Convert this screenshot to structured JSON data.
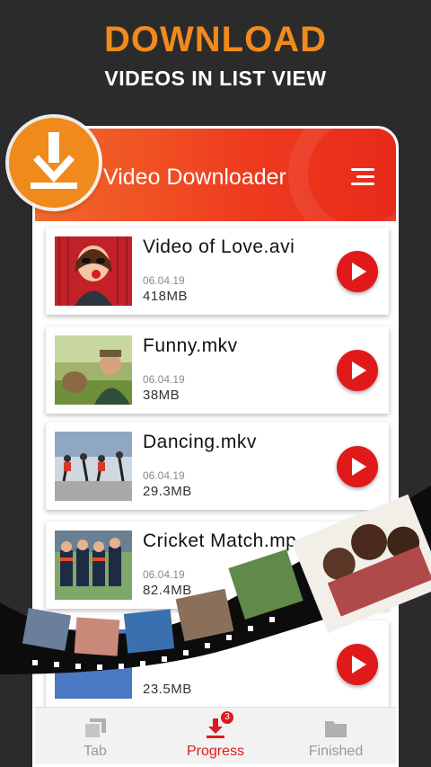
{
  "promo": {
    "title": "DOWNLOAD",
    "subtitle": "VIDEOS IN LIST VIEW"
  },
  "appbar": {
    "title": "Video Downloader",
    "menu_icon": "hamburger-menu-icon",
    "badge_icon": "download-arrow-icon"
  },
  "videos": [
    {
      "title": "Video of Love.avi",
      "date": "06.04.19",
      "size": "418MB"
    },
    {
      "title": "Funny.mkv",
      "date": "06.04.19",
      "size": "38MB"
    },
    {
      "title": "Dancing.mkv",
      "date": "06.04.19",
      "size": "29.3MB"
    },
    {
      "title": "Cricket Match.mp",
      "date": "06.04.19",
      "size": "82.4MB"
    },
    {
      "title": "",
      "date": "",
      "size": "23.5MB"
    }
  ],
  "bottom_nav": {
    "items": [
      {
        "label": "Tab",
        "icon": "tabs-icon"
      },
      {
        "label": "Progress",
        "icon": "download-progress-icon",
        "badge": "3"
      },
      {
        "label": "Finished",
        "icon": "folder-icon"
      }
    ]
  },
  "colors": {
    "accent_orange": "#f08a1c",
    "appbar_red": "#ee3a1e",
    "play_red": "#e0191b",
    "background": "#2b2b2b"
  }
}
